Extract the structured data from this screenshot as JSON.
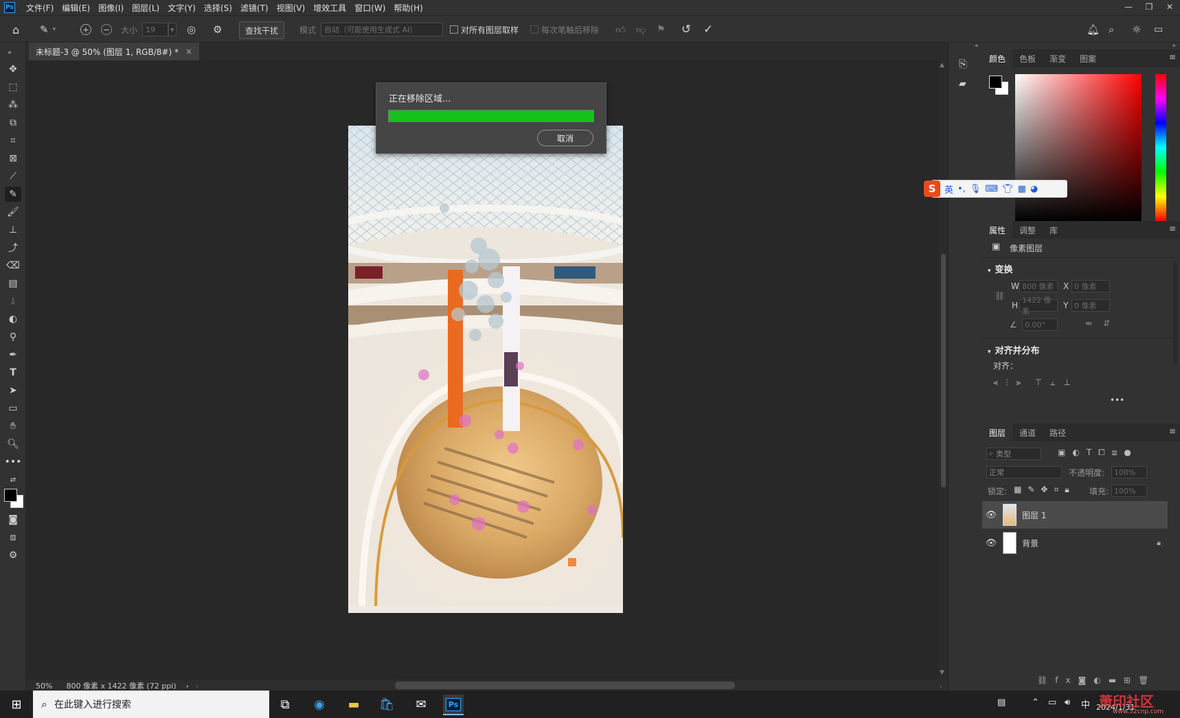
{
  "app": {
    "logo": "Ps"
  },
  "menu": [
    "文件(F)",
    "编辑(E)",
    "图像(I)",
    "图层(L)",
    "文字(Y)",
    "选择(S)",
    "滤镜(T)",
    "视图(V)",
    "增效工具",
    "窗口(W)",
    "帮助(H)"
  ],
  "window_controls": [
    "minimize-icon",
    "restore-icon",
    "close-icon"
  ],
  "options_bar": {
    "size_label": "大小",
    "size_value": "19",
    "find_distractions": "查找干扰",
    "mode_label": "模式",
    "mode_value": "自动（可能使用生成式 AI）",
    "sample_all_layers": "对所有图层取样",
    "remove_after_stroke": "每次笔触后移除"
  },
  "document": {
    "tab_title": "未标题-3 @ 50% (图层 1, RGB/8#) *",
    "close_glyph": "×"
  },
  "status": {
    "zoom": "50%",
    "doc_info": "800 像素 x 1422 像素 (72 ppi)"
  },
  "dialog": {
    "title": "正在移除区域...",
    "progress_fraction": 1.0,
    "progress_color": "#14c21b",
    "cancel_label": "取消"
  },
  "color_panel": {
    "tabs": [
      "颜色",
      "色板",
      "渐变",
      "图案"
    ],
    "foreground": "#000000",
    "background": "#ffffff",
    "hue": "#ff0000"
  },
  "properties_panel": {
    "tabs": [
      "属性",
      "调整",
      "库"
    ],
    "layer_type": "像素图层",
    "transform_label": "变换",
    "w_label": "W",
    "w_value": "800 像素",
    "h_label": "H",
    "h_value": "1422 像素",
    "x_label": "X",
    "x_value": "0 像素",
    "y_label": "Y",
    "y_value": "0 像素",
    "angle_value": "0.00°",
    "align_title": "对齐并分布",
    "align_label": "对齐：",
    "more": "•••"
  },
  "layers_panel": {
    "tabs": [
      "图层",
      "通道",
      "路径"
    ],
    "filter_placeholder": "类型",
    "blend_mode": "正常",
    "opacity_label": "不透明度:",
    "opacity_value": "100%",
    "lock_label": "锁定:",
    "fill_label": "填充:",
    "fill_value": "100%",
    "layers": [
      {
        "name": "图层 1",
        "selected": true
      },
      {
        "name": "背景",
        "selected": false
      }
    ]
  },
  "ime": {
    "lang": "英"
  },
  "taskbar": {
    "search_placeholder": "在此键入进行搜索",
    "ime_mode": "中",
    "date": "2024/1/31",
    "watermark": "萧印社区",
    "watermark_url": "www.52cnp.com"
  }
}
